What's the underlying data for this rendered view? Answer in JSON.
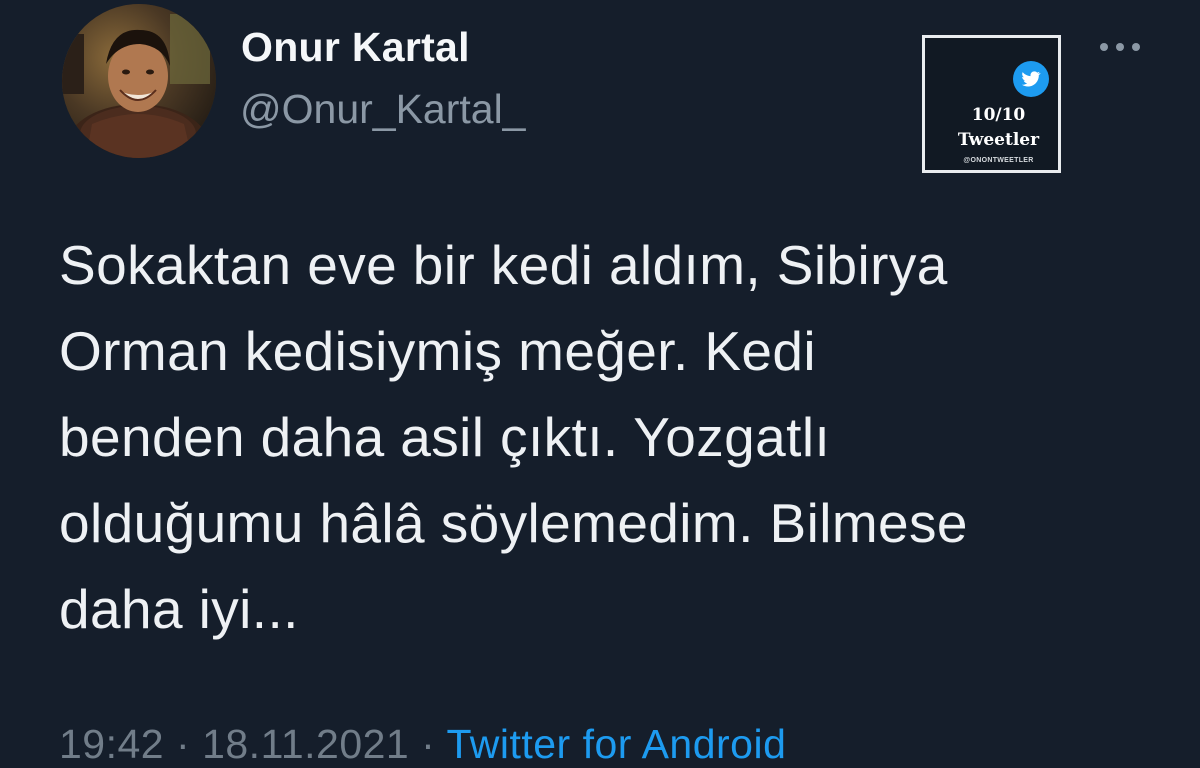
{
  "tweet": {
    "author": {
      "display_name": "Onur Kartal",
      "handle": "@Onur_Kartal_"
    },
    "badge": {
      "score": "10/10",
      "label": "Tweetler",
      "handle": "@ONONTWEETLER",
      "icon": "twitter-bird-icon"
    },
    "more_icon": "more-horizontal-icon",
    "text_lines": [
      "Sokaktan eve bir kedi aldım, Sibirya",
      "Orman kedisiymiş meğer. Kedi",
      "benden daha asil çıktı. Yozgatlı",
      "olduğumu hâlâ söylemedim. Bilmese",
      "daha iyi..."
    ],
    "time": "19:42",
    "separator": "·",
    "date": "18.11.2021",
    "source": "Twitter for Android"
  },
  "colors": {
    "background": "#151e2b",
    "text": "#eef1f4",
    "muted": "#8b98a5",
    "accent": "#1d9bf0"
  }
}
